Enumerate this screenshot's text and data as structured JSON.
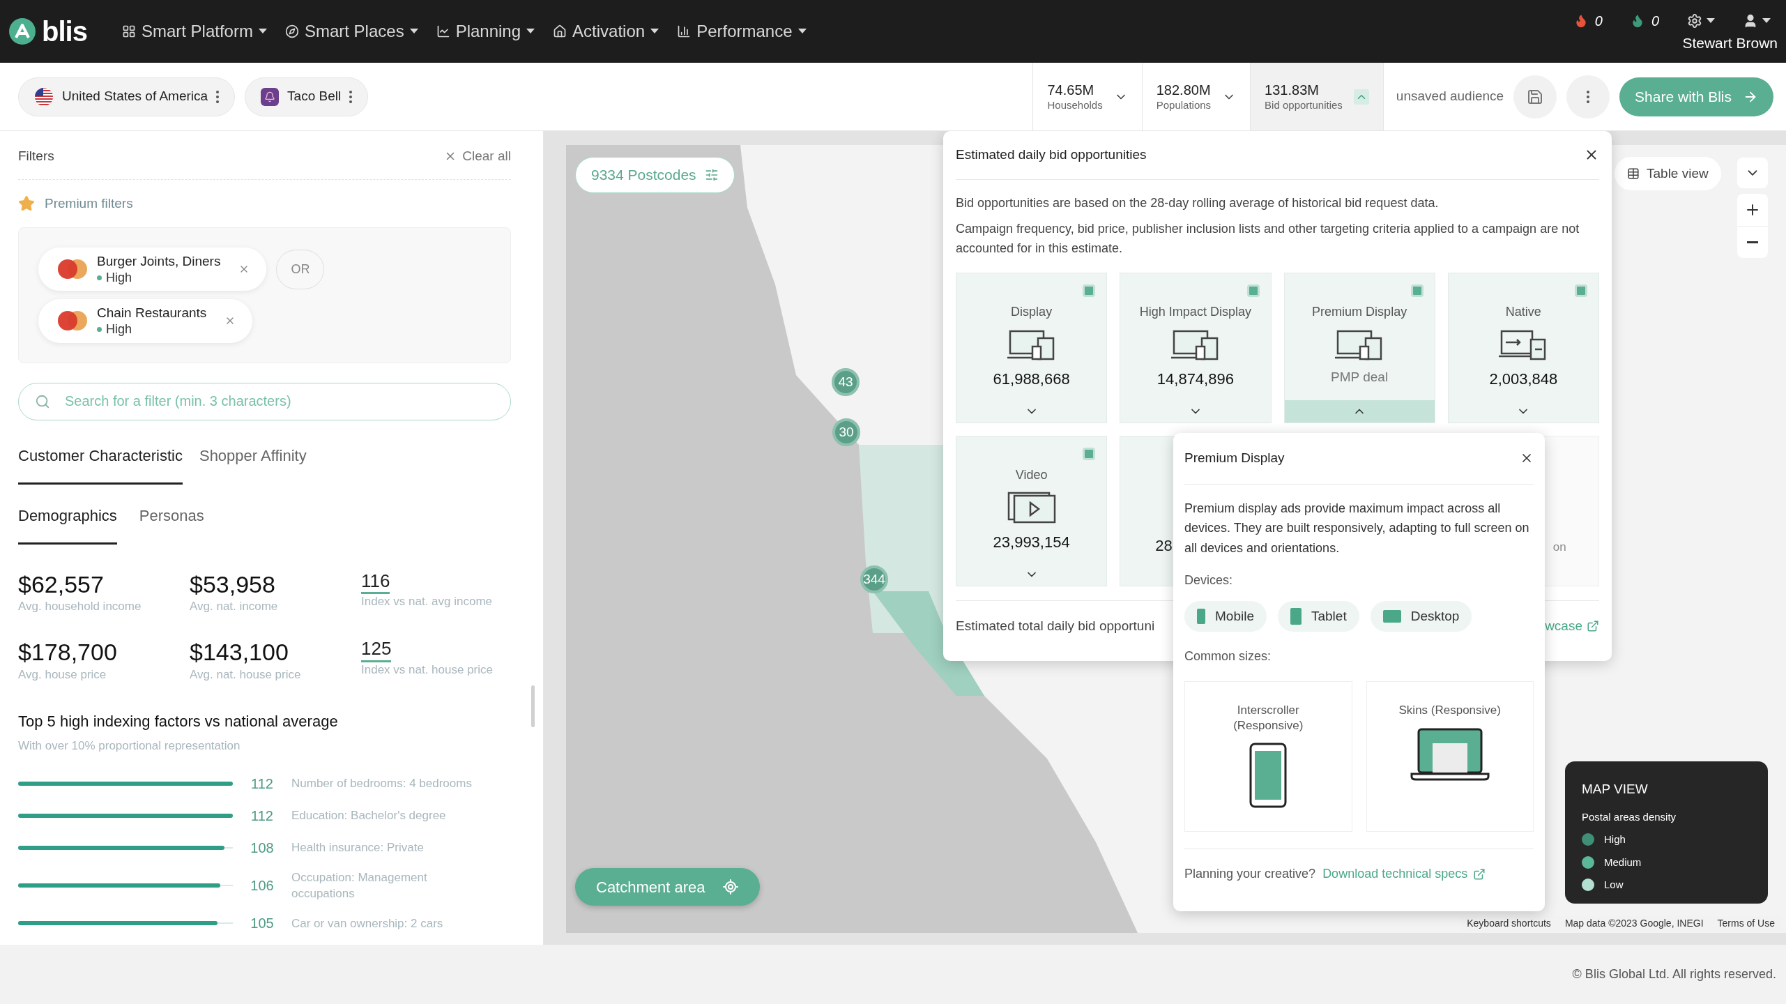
{
  "nav": {
    "logo": "blis",
    "items": [
      {
        "label": "Smart Platform"
      },
      {
        "label": "Smart Places"
      },
      {
        "label": "Planning"
      },
      {
        "label": "Activation"
      },
      {
        "label": "Performance"
      }
    ],
    "alerts": [
      {
        "count": "0",
        "color": "#e5533d"
      },
      {
        "count": "0",
        "color": "#3d9b7a"
      }
    ],
    "user": "Stewart Brown"
  },
  "context_chips": [
    {
      "label": "United States of America",
      "kind": "country"
    },
    {
      "label": "Taco Bell",
      "kind": "brand"
    }
  ],
  "metrics": [
    {
      "value": "74.65M",
      "label": "Households",
      "expanded": false
    },
    {
      "value": "182.80M",
      "label": "Populations",
      "expanded": false
    },
    {
      "value": "131.83M",
      "label": "Bid opportunities",
      "expanded": true
    }
  ],
  "audience_name": "unsaved audience",
  "share_button": "Share with Blis",
  "filters": {
    "title": "Filters",
    "clear": "Clear all",
    "premium_label": "Premium filters",
    "operator": "OR",
    "search_placeholder": "Search for a filter (min. 3 characters)",
    "chips": [
      {
        "name": "Burger Joints, Diners",
        "strength": "High"
      },
      {
        "name": "Chain Restaurants",
        "strength": "High"
      }
    ]
  },
  "tabs": [
    {
      "label": "Customer Characteristic",
      "selected": true
    },
    {
      "label": "Shopper Affinity",
      "selected": false
    }
  ],
  "subtabs": [
    {
      "label": "Demographics",
      "selected": true
    },
    {
      "label": "Personas",
      "selected": false
    }
  ],
  "stats": [
    {
      "value": "$62,557",
      "label": "Avg. household income",
      "kind": "amount"
    },
    {
      "value": "$53,958",
      "label": "Avg. nat. income",
      "kind": "amount"
    },
    {
      "value": "116",
      "label": "Index vs nat. avg income",
      "kind": "index"
    },
    {
      "value": "$178,700",
      "label": "Avg. house price",
      "kind": "amount"
    },
    {
      "value": "$143,100",
      "label": "Avg. nat. house price",
      "kind": "amount"
    },
    {
      "value": "125",
      "label": "Index vs nat. house price",
      "kind": "index"
    }
  ],
  "top_factors": {
    "title": "Top 5 high indexing factors vs national average",
    "subtitle": "With over 10% proportional representation",
    "rows": [
      {
        "value": "112",
        "label": "Number of bedrooms: 4 bedrooms",
        "level": 1.0
      },
      {
        "value": "112",
        "label": "Education: Bachelor's degree",
        "level": 1.0
      },
      {
        "value": "108",
        "label": "Health insurance: Private",
        "level": 0.96
      },
      {
        "value": "106",
        "label": "Occupation: Management occupations",
        "level": 0.94
      },
      {
        "value": "105",
        "label": "Car or van ownership: 2 cars",
        "level": 0.93
      }
    ]
  },
  "map": {
    "postcodes": "9334 Postcodes",
    "table_view": "Table view",
    "catchment": "Catchment area",
    "clusters": [
      {
        "count": "43"
      },
      {
        "count": "30"
      },
      {
        "count": "344"
      }
    ],
    "attribution": [
      "Keyboard shortcuts",
      "Map data ©2023 Google, INEGI",
      "Terms of Use"
    ],
    "legend": {
      "title": "MAP VIEW",
      "subtitle": "Postal areas density",
      "items": [
        {
          "label": "High",
          "color": "#3f8f76"
        },
        {
          "label": "Medium",
          "color": "#5bb898"
        },
        {
          "label": "Low",
          "color": "#b3e0d0"
        }
      ]
    }
  },
  "bid_popup": {
    "title": "Estimated daily bid opportunities",
    "paragraphs": [
      "Bid opportunities are based on the 28-day rolling average of historical bid request data.",
      "Campaign frequency, bid price, publisher inclusion lists and other targeting criteria applied to a campaign are not accounted for in this estimate."
    ],
    "cards": [
      {
        "label": "Display",
        "value": "61,988,668",
        "kind": "display",
        "checked": true,
        "expanded": false,
        "muted": false
      },
      {
        "label": "High Impact Display",
        "value": "14,874,896",
        "kind": "display",
        "checked": true,
        "expanded": false,
        "muted": false
      },
      {
        "label": "Premium Display",
        "value": "PMP deal",
        "kind": "display",
        "checked": true,
        "expanded": true,
        "muted": true
      },
      {
        "label": "Native",
        "value": "2,003,848",
        "kind": "native",
        "checked": true,
        "expanded": false,
        "muted": false
      },
      {
        "label": "Video",
        "value": "23,993,154",
        "kind": "video",
        "checked": true,
        "expanded": false,
        "muted": false
      },
      {
        "value": "28",
        "kind": "partial"
      },
      {
        "kind": "hidden"
      },
      {
        "value": "on",
        "kind": "faded"
      }
    ],
    "total_label": "Estimated total daily bid opportuni",
    "showcase_link": "wcase"
  },
  "premium_popup": {
    "title": "Premium Display",
    "description": "Premium display ads provide maximum impact across all devices. They are built responsively, adapting to full screen on all devices and orientations.",
    "devices_label": "Devices:",
    "devices": [
      {
        "label": "Mobile",
        "kind": "mobile"
      },
      {
        "label": "Tablet",
        "kind": "tablet"
      },
      {
        "label": "Desktop",
        "kind": "desktop"
      }
    ],
    "sizes_label": "Common sizes:",
    "sizes": [
      {
        "label": "Interscroller (Responsive)",
        "kind": "phone"
      },
      {
        "label": "Skins (Responsive)",
        "kind": "laptop"
      }
    ],
    "footer_text": "Planning your creative?",
    "footer_link": "Download technical specs"
  },
  "copyright": "© Blis Global Ltd. All rights reserved."
}
